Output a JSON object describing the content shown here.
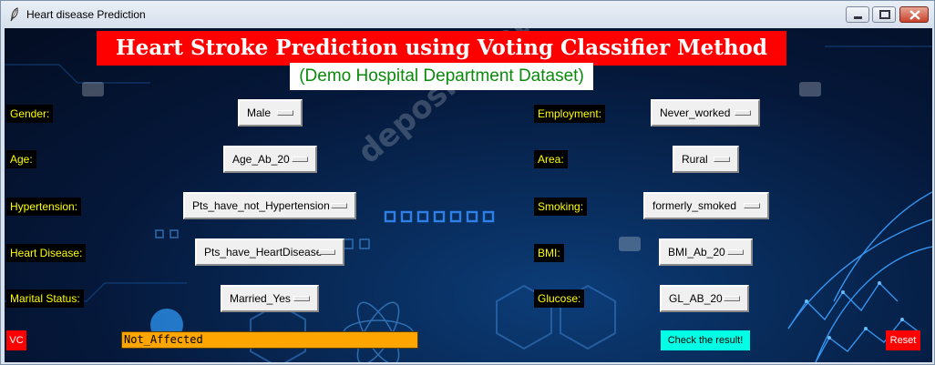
{
  "window": {
    "title": "Heart disease Prediction",
    "icons": {
      "app": "feather-icon",
      "minimize": "minimize-icon",
      "maximize": "maximize-icon",
      "close": "close-icon"
    }
  },
  "header": {
    "title": "Heart Stroke Prediction using Voting Classifier Method",
    "subtitle": "(Demo Hospital Department Dataset)"
  },
  "left_fields": [
    {
      "label": "Gender:",
      "value": "Male"
    },
    {
      "label": "Age:",
      "value": "Age_Ab_20"
    },
    {
      "label": "Hypertension:",
      "value": "Pts_have_not_Hypertension"
    },
    {
      "label": "Heart Disease:",
      "value": "Pts_have_HeartDisease"
    },
    {
      "label": "Marital Status:",
      "value": "Married_Yes"
    }
  ],
  "right_fields": [
    {
      "label": "Employment:",
      "value": "Never_worked"
    },
    {
      "label": "Area:",
      "value": "Rural"
    },
    {
      "label": "Smoking:",
      "value": "formerly_smoked"
    },
    {
      "label": "BMI:",
      "value": "BMI_Ab_20"
    },
    {
      "label": "Glucose:",
      "value": "GL_AB_20"
    }
  ],
  "actions": {
    "vc_label": "VC",
    "result_value": "Not_Affected",
    "check_label": "Check the result!",
    "reset_label": "Reset"
  },
  "colors": {
    "heading_bg": "#ff0000",
    "subtitle_text": "#0a8a0a",
    "label_text": "#ffff00",
    "result_bg": "#ffa500",
    "check_bg": "#00ffe5",
    "reset_bg": "#ff0000"
  }
}
